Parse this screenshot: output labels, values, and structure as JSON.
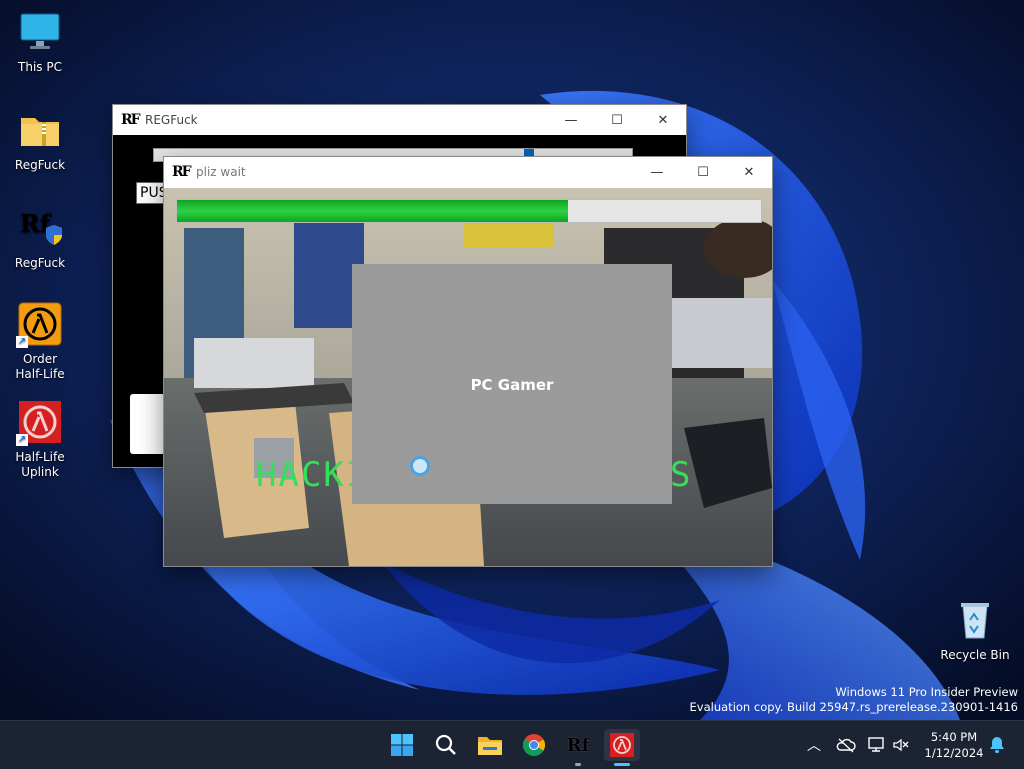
{
  "desktop": {
    "icons": [
      {
        "label": "This PC"
      },
      {
        "label": "RegFuck"
      },
      {
        "label": "RegFuck"
      },
      {
        "label": "Order\nHalf-Life"
      },
      {
        "label": "Half-Life\nUplink"
      },
      {
        "label": "Recycle Bin"
      }
    ],
    "watermark": {
      "line1": "Windows 11 Pro Insider Preview",
      "line2": "Evaluation copy. Build 25947.rs_prerelease.230901-1416"
    }
  },
  "windows": {
    "regfuck": {
      "title": "REGFuck",
      "button_text": "PUS"
    },
    "pliz_wait": {
      "title": "pliz wait",
      "progress": 0.67,
      "overlay_text": "HACKI",
      "overlay_text_right": "S",
      "popup_title": "PC Gamer"
    }
  },
  "taskbar": {
    "clock_time": "5:40 PM",
    "clock_date": "1/12/2024"
  },
  "colors": {
    "accent": "#0067c0",
    "progress_green": "#16b42e",
    "hack_text": "#34e05a",
    "taskbar": "#1c2333"
  }
}
